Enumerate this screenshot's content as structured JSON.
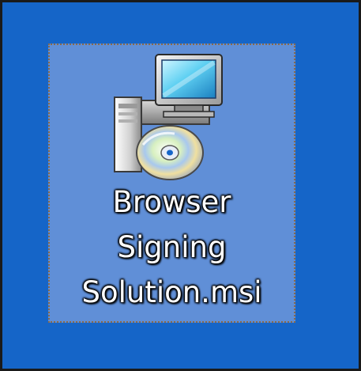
{
  "desktop": {
    "background_color": "#1565c8",
    "selected_item": {
      "icon_name": "installer-package-icon",
      "label_lines": [
        "Browser",
        "Signing",
        "Solution.msi"
      ],
      "selection_color": "#7ea0dc"
    }
  }
}
